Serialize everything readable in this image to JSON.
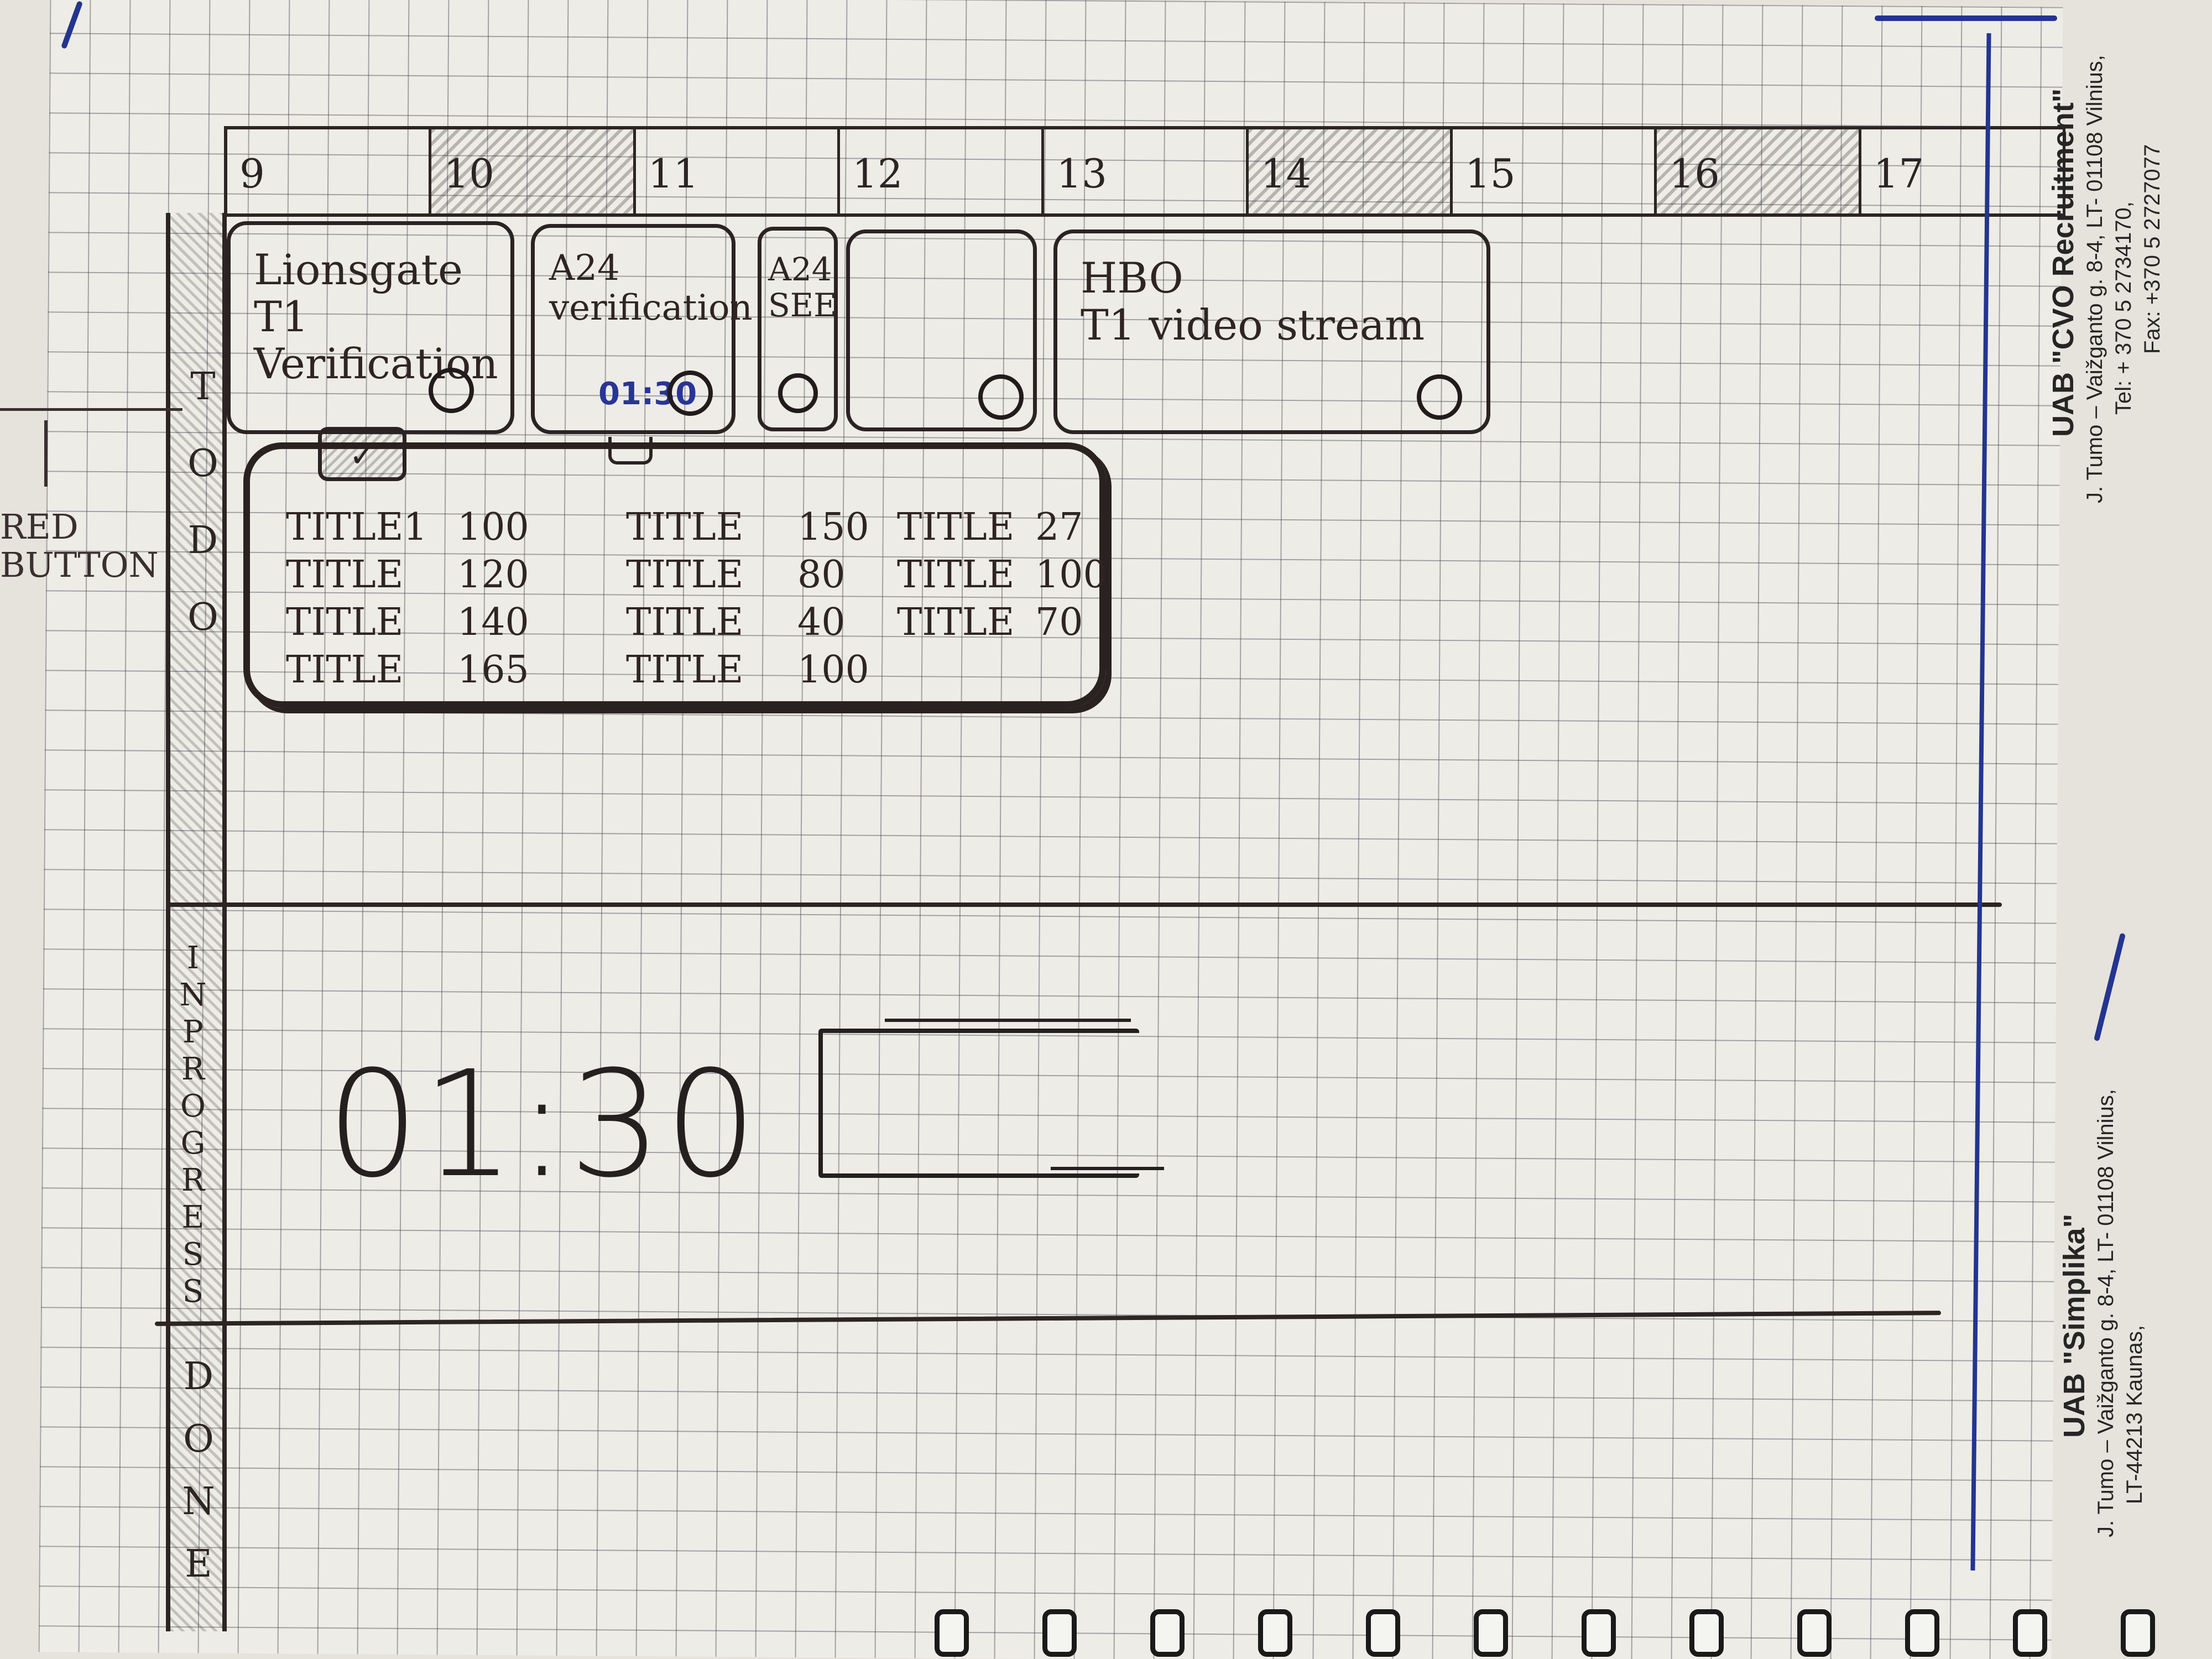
{
  "timeline": {
    "hours": [
      "9",
      "10",
      "11",
      "12",
      "13",
      "14",
      "15",
      "16",
      "17"
    ]
  },
  "lanes": {
    "todo": "TODO",
    "in_progress": "INPROGRESS",
    "done": "DONE"
  },
  "cards": [
    {
      "title": "Lionsgate T1\nVerification",
      "timer": ""
    },
    {
      "title": "A24\nverification",
      "timer": "01:30"
    },
    {
      "title": "A24\nSEE",
      "timer": ""
    },
    {
      "title": "",
      "timer": ""
    },
    {
      "title": "HBO\nT1 video stream",
      "timer": ""
    }
  ],
  "task_list": {
    "columns": [
      [
        {
          "title": "TITLE1",
          "value": "100"
        },
        {
          "title": "TITLE",
          "value": "120"
        },
        {
          "title": "TITLE",
          "value": "140"
        },
        {
          "title": "TITLE",
          "value": "165"
        }
      ],
      [
        {
          "title": "TITLE",
          "value": "150"
        },
        {
          "title": "TITLE",
          "value": "80"
        },
        {
          "title": "TITLE",
          "value": "40"
        },
        {
          "title": "TITLE",
          "value": "100"
        }
      ],
      [
        {
          "title": "TITLE",
          "value": "27"
        },
        {
          "title": "TITLE",
          "value": "100"
        },
        {
          "title": "TITLE",
          "value": "70"
        }
      ]
    ]
  },
  "in_progress": {
    "timer": "01:30"
  },
  "annotation": {
    "line1": "RED",
    "line2": "BUTTON"
  },
  "stamps": {
    "cvo": {
      "name": "UAB \"CVO Recruitment\"",
      "address": "J. Tumo – Vaižganto g. 8-4, LT- 01108 Vilnius,",
      "tel": "Tel: + 370 5 2734170,",
      "fax": "Fax: +370 5 2727077"
    },
    "simplika": {
      "name": "UAB \"Simplika\"",
      "address": "J. Tumo – Vaižganto g. 8-4, LT- 01108 Vilnius,",
      "address2": "LT-44213 Kaunas,"
    }
  },
  "colors": {
    "ink": "#2b2323",
    "blue_ink": "#283596",
    "paper": "#eeece6"
  }
}
